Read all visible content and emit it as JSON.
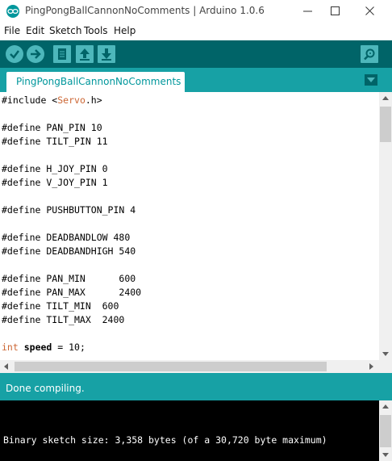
{
  "window": {
    "title": "PingPongBallCannonNoComments | Arduino 1.0.6",
    "minimize_icon": "minimize-icon",
    "maximize_icon": "maximize-icon",
    "close_icon": "close-icon"
  },
  "menu": {
    "items": [
      "File",
      "Edit",
      "Sketch",
      "Tools",
      "Help"
    ]
  },
  "toolbar": {
    "buttons": [
      "verify-icon",
      "upload-icon",
      "new-icon",
      "open-icon",
      "save-icon",
      "serial-monitor-icon"
    ]
  },
  "tabs": {
    "active_label": "PingPongBallCannonNoComments"
  },
  "editor": {
    "lines": [
      "#include <Servo.h>",
      "",
      "#define PAN_PIN 10",
      "#define TILT_PIN 11",
      "",
      "#define H_JOY_PIN 0",
      "#define V_JOY_PIN 1",
      "",
      "#define PUSHBUTTON_PIN 4",
      "",
      "#define DEADBANDLOW 480",
      "#define DEADBANDHIGH 540",
      "",
      "#define PAN_MIN      600",
      "#define PAN_MAX      2400",
      "#define TILT_MIN  600",
      "#define TILT_MAX  2400",
      "",
      "int speed = 10;"
    ]
  },
  "status": {
    "message": "Done compiling."
  },
  "console": {
    "output": "Binary sketch size: 3,358 bytes (of a 30,720 byte maximum)"
  },
  "colors": {
    "toolbar": "#006468",
    "tabbar": "#17a1a5",
    "tab_text": "#00979c",
    "keyword": "#cc6633",
    "console_bg": "#000000"
  }
}
